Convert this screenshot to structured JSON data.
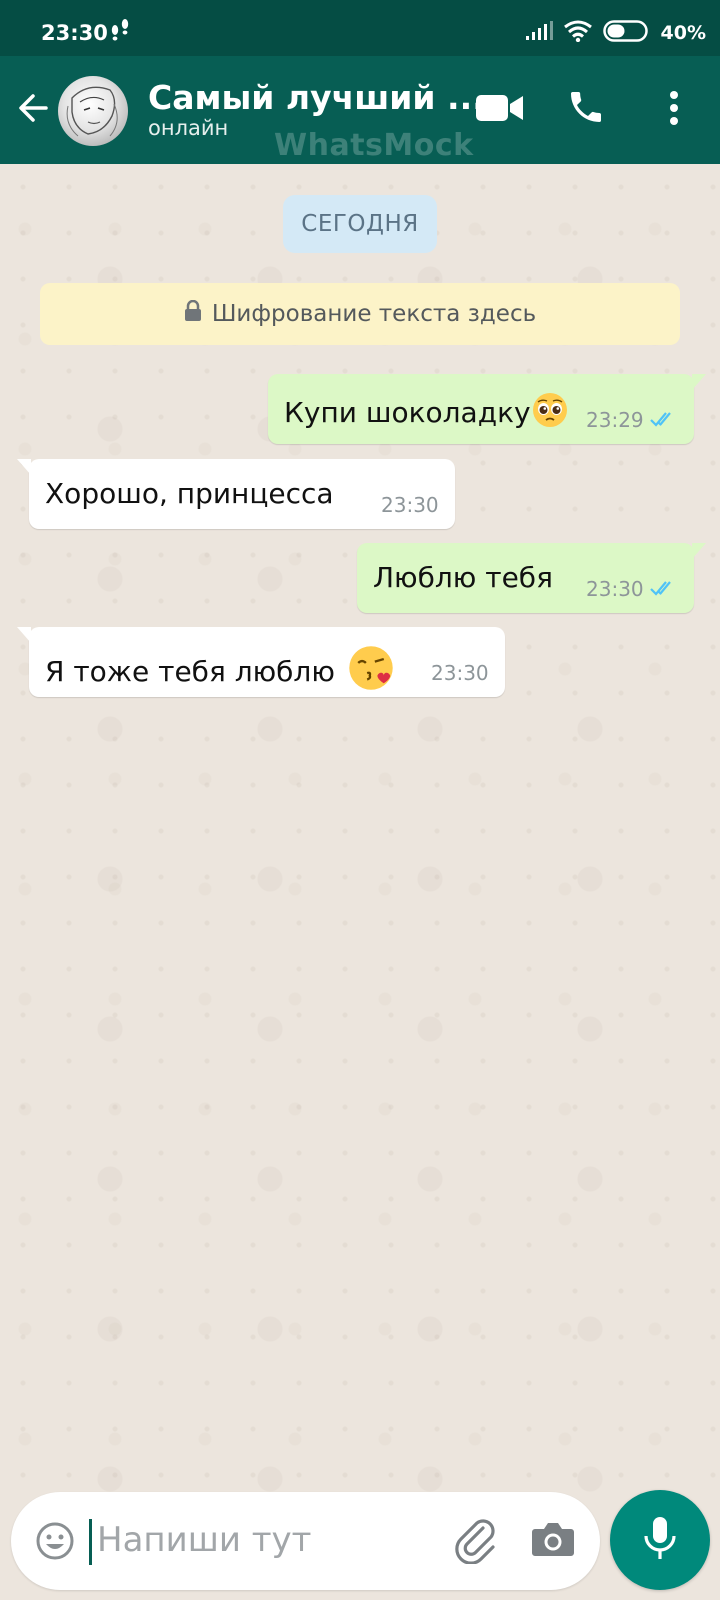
{
  "status_bar": {
    "time": "23:30",
    "battery": "40%"
  },
  "header": {
    "contact_name": "Самый лучший ...",
    "status": "онлайн",
    "watermark": "WhatsMock"
  },
  "chat": {
    "date_chip": "СЕГОДНЯ",
    "encryption_notice": "Шифрование текста здесь",
    "messages": [
      {
        "direction": "outgoing",
        "text": "Купи шоколадку",
        "emoji": "pleading-face",
        "time": "23:29",
        "read": true
      },
      {
        "direction": "incoming",
        "text": "Хорошо, принцесса",
        "time": "23:30"
      },
      {
        "direction": "outgoing",
        "text": "Люблю тебя",
        "time": "23:30",
        "read": true
      },
      {
        "direction": "incoming",
        "text": "Я тоже тебя люблю",
        "emoji": "kissing-face",
        "time": "23:30"
      }
    ]
  },
  "composer": {
    "placeholder": "Напиши тут"
  },
  "colors": {
    "header": "#075e54",
    "status_bar": "#054d44",
    "outgoing_bubble": "#dcf8c6",
    "incoming_bubble": "#ffffff",
    "read_ticks": "#4fc3f7",
    "fab": "#00897b"
  },
  "icons": {
    "back": "arrow-left-icon",
    "video": "video-camera-icon",
    "call": "phone-icon",
    "menu": "more-vertical-icon",
    "lock": "lock-icon",
    "emoji": "emoji-icon",
    "attach": "paperclip-icon",
    "camera": "camera-icon",
    "mic": "microphone-icon"
  }
}
